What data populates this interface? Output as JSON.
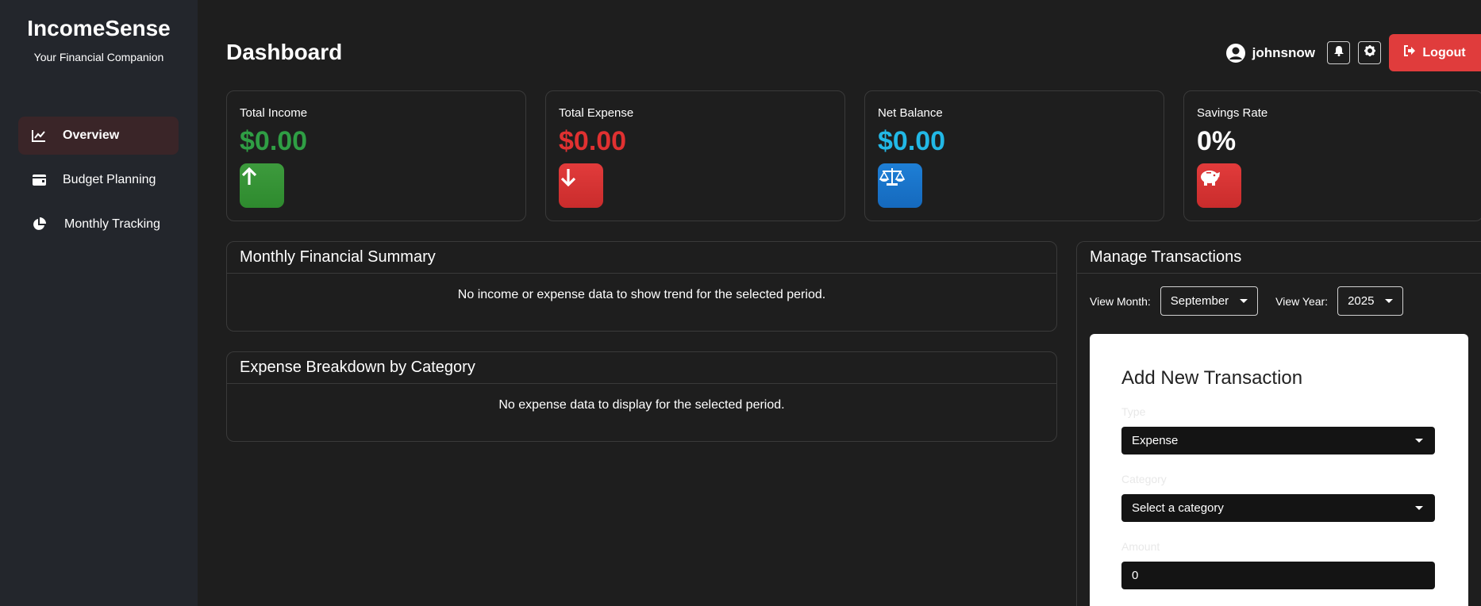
{
  "brand": {
    "title": "IncomeSense",
    "subtitle": "Your Financial Companion"
  },
  "sidebar": {
    "items": [
      {
        "label": "Overview",
        "icon": "line-chart-icon",
        "active": true
      },
      {
        "label": "Budget Planning",
        "icon": "wallet-icon",
        "active": false
      },
      {
        "label": "Monthly Tracking",
        "icon": "pie-chart-icon",
        "active": false
      }
    ]
  },
  "header": {
    "title": "Dashboard",
    "username": "johnsnow",
    "logout_label": "Logout"
  },
  "stats": [
    {
      "label": "Total Income",
      "value": "$0.00",
      "color": "#2f9e44",
      "icon": "arrow-up-icon"
    },
    {
      "label": "Total Expense",
      "value": "$0.00",
      "color": "#e03131",
      "icon": "arrow-down-icon"
    },
    {
      "label": "Net Balance",
      "value": "$0.00",
      "color": "#22b8e6",
      "icon": "balance-scale-icon"
    },
    {
      "label": "Savings Rate",
      "value": "0%",
      "color": "#ffffff",
      "icon": "piggy-bank-icon"
    }
  ],
  "panels": {
    "monthly_summary": {
      "title": "Monthly Financial Summary",
      "empty_text": "No income or expense data to show trend for the selected period."
    },
    "expense_breakdown": {
      "title": "Expense Breakdown by Category",
      "empty_text": "No expense data to display for the selected period."
    }
  },
  "transactions": {
    "title": "Manage Transactions",
    "view_month_label": "View Month:",
    "view_month_value": "September",
    "view_year_label": "View Year:",
    "view_year_value": "2025",
    "form": {
      "title": "Add New Transaction",
      "type_label": "Type",
      "type_value": "Expense",
      "category_label": "Category",
      "category_value": "Select a category",
      "amount_label": "Amount",
      "amount_value": "0"
    }
  }
}
